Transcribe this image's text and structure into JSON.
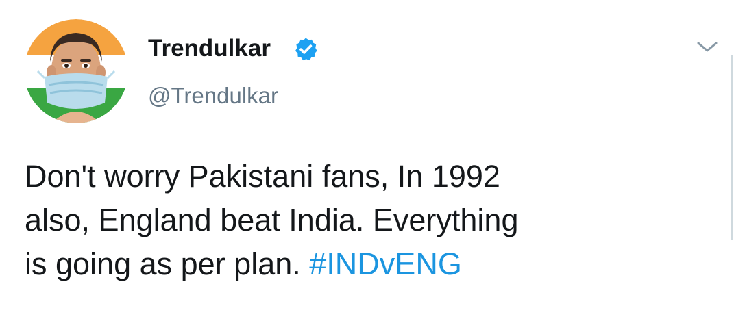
{
  "author": {
    "display_name": "Trendulkar",
    "handle": "@Trendulkar",
    "verified_icon": "verified-badge-icon",
    "avatar": "avatar-image"
  },
  "menu_icon": "chevron-down-icon",
  "tweet": {
    "line1": "Don't worry Pakistani fans, In 1992",
    "line2": "also, England beat India. Everything",
    "line3_text": "is going as per plan.",
    "hashtag": "#INDvENG"
  },
  "colors": {
    "name": "#14171a",
    "handle": "#657786",
    "hashtag": "#1b95e0",
    "verified": "#1da1f2"
  }
}
